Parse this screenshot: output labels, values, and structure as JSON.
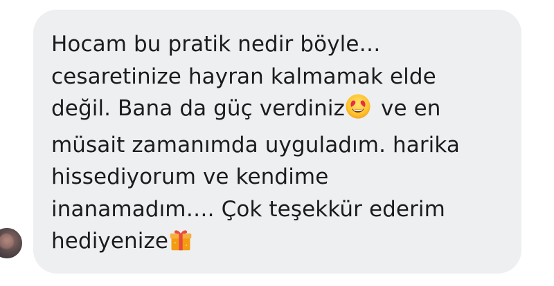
{
  "message": {
    "lines": [
      "Hocam bu pratik nedir böyle…",
      "cesaretinize hayran kalmamak elde",
      "değil. Bana da güç verdiniz",
      "ve en",
      "müsait zamanımda uyguladım. harika",
      "hissediyorum ve kendime",
      "inanamadım…. Çok teşekkür ederim",
      "hediyenize"
    ],
    "emoji_1": "heart-eyes-emoji",
    "emoji_2": "gift-emoji"
  },
  "colors": {
    "bubble_bg": "#eeeff1",
    "text": "#1c1c1e"
  }
}
